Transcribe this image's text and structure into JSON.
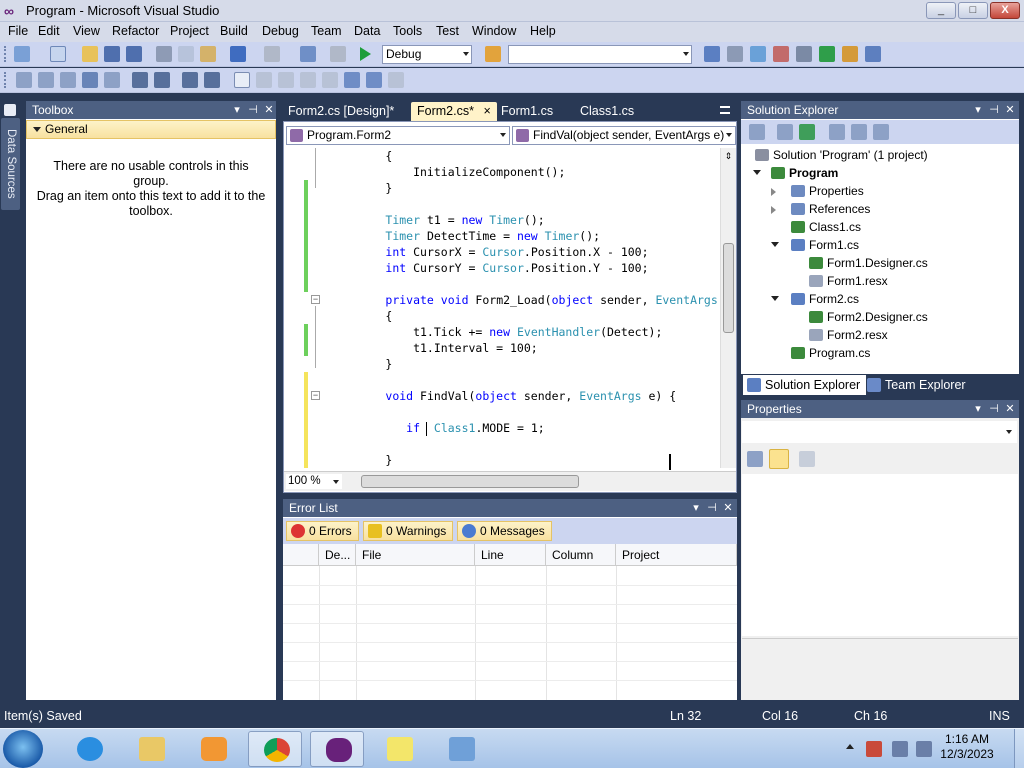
{
  "window": {
    "title": "Program - Microsoft Visual Studio",
    "min": "_",
    "max": "□",
    "close": "X"
  },
  "menu": [
    "File",
    "Edit",
    "View",
    "Refactor",
    "Project",
    "Build",
    "Debug",
    "Team",
    "Data",
    "Tools",
    "Test",
    "Window",
    "Help"
  ],
  "toolbar": {
    "config": "Debug",
    "platform": ""
  },
  "left_strip": {
    "data_sources": "Data Sources"
  },
  "toolbox": {
    "title": "Toolbox",
    "group": "General",
    "empty_line1": "There are no usable controls in this group.",
    "empty_line2": "Drag an item onto this text to add it to the",
    "empty_line3": "toolbox."
  },
  "pane_controls": {
    "pin": "⊣",
    "dropdown": "▾",
    "close": "✕"
  },
  "doc_tabs": [
    {
      "label": "Form2.cs [Design]*"
    },
    {
      "label": "Form2.cs*",
      "close": "×"
    },
    {
      "label": "Form1.cs"
    },
    {
      "label": "Class1.cs"
    }
  ],
  "editor": {
    "class_combo": "Program.Form2",
    "member_combo": "FindVal(object sender, EventArgs e)",
    "zoom": "100 %",
    "lines": [
      {
        "y": 0,
        "parts": [
          {
            "t": "        {",
            "c": ""
          }
        ]
      },
      {
        "y": 1,
        "parts": [
          {
            "t": "            InitializeComponent();",
            "c": ""
          }
        ]
      },
      {
        "y": 2,
        "parts": [
          {
            "t": "        }",
            "c": ""
          }
        ]
      },
      {
        "y": 4,
        "parts": [
          {
            "t": "        ",
            "c": ""
          },
          {
            "t": "Timer",
            "c": "t"
          },
          {
            "t": " t1 = ",
            "c": ""
          },
          {
            "t": "new",
            "c": "k"
          },
          {
            "t": " ",
            "c": ""
          },
          {
            "t": "Timer",
            "c": "t"
          },
          {
            "t": "();",
            "c": ""
          }
        ]
      },
      {
        "y": 5,
        "parts": [
          {
            "t": "        ",
            "c": ""
          },
          {
            "t": "Timer",
            "c": "t"
          },
          {
            "t": " DetectTime = ",
            "c": ""
          },
          {
            "t": "new",
            "c": "k"
          },
          {
            "t": " ",
            "c": ""
          },
          {
            "t": "Timer",
            "c": "t"
          },
          {
            "t": "();",
            "c": ""
          }
        ]
      },
      {
        "y": 6,
        "parts": [
          {
            "t": "        ",
            "c": ""
          },
          {
            "t": "int",
            "c": "k"
          },
          {
            "t": " CursorX = ",
            "c": ""
          },
          {
            "t": "Cursor",
            "c": "t"
          },
          {
            "t": ".Position.X - 100;",
            "c": ""
          }
        ]
      },
      {
        "y": 7,
        "parts": [
          {
            "t": "        ",
            "c": ""
          },
          {
            "t": "int",
            "c": "k"
          },
          {
            "t": " CursorY = ",
            "c": ""
          },
          {
            "t": "Cursor",
            "c": "t"
          },
          {
            "t": ".Position.Y - 100;",
            "c": ""
          }
        ]
      },
      {
        "y": 9,
        "parts": [
          {
            "t": "        ",
            "c": ""
          },
          {
            "t": "private",
            "c": "k"
          },
          {
            "t": " ",
            "c": ""
          },
          {
            "t": "void",
            "c": "k"
          },
          {
            "t": " Form2_Load(",
            "c": ""
          },
          {
            "t": "object",
            "c": "k"
          },
          {
            "t": " sender, ",
            "c": ""
          },
          {
            "t": "EventArgs",
            "c": "t"
          }
        ]
      },
      {
        "y": 10,
        "parts": [
          {
            "t": "        {",
            "c": ""
          }
        ]
      },
      {
        "y": 11,
        "parts": [
          {
            "t": "            t1.Tick += ",
            "c": ""
          },
          {
            "t": "new",
            "c": "k"
          },
          {
            "t": " ",
            "c": ""
          },
          {
            "t": "EventHandler",
            "c": "t"
          },
          {
            "t": "(Detect);",
            "c": ""
          }
        ]
      },
      {
        "y": 12,
        "parts": [
          {
            "t": "            t1.Interval = 100;",
            "c": ""
          }
        ]
      },
      {
        "y": 13,
        "parts": [
          {
            "t": "        }",
            "c": ""
          }
        ]
      },
      {
        "y": 15,
        "parts": [
          {
            "t": "        ",
            "c": ""
          },
          {
            "t": "void",
            "c": "k"
          },
          {
            "t": " FindVal(",
            "c": ""
          },
          {
            "t": "object",
            "c": "k"
          },
          {
            "t": " sender, ",
            "c": ""
          },
          {
            "t": "EventArgs",
            "c": "t"
          },
          {
            "t": " e) {",
            "c": ""
          }
        ]
      },
      {
        "y": 17,
        "parts": [
          {
            "t": "           ",
            "c": ""
          },
          {
            "t": "if",
            "c": "k"
          },
          {
            "t": "  ",
            "c": ""
          },
          {
            "t": "Class1",
            "c": "t"
          },
          {
            "t": ".MODE = 1;",
            "c": ""
          }
        ]
      },
      {
        "y": 19,
        "parts": [
          {
            "t": "        }",
            "c": ""
          }
        ]
      }
    ]
  },
  "error_list": {
    "title": "Error List",
    "errors": "0 Errors",
    "warnings": "0 Warnings",
    "messages": "0 Messages",
    "columns": [
      "De...",
      "File",
      "Line",
      "Column",
      "Project"
    ]
  },
  "solution_explorer": {
    "title": "Solution Explorer",
    "tree": [
      {
        "label": "Solution 'Program' (1 project)",
        "level": 0,
        "bold": false,
        "exp": "",
        "icon": "solution-icon"
      },
      {
        "label": "Program",
        "level": 1,
        "bold": true,
        "exp": "open",
        "icon": "csharp-project-icon"
      },
      {
        "label": "Properties",
        "level": 2,
        "bold": false,
        "exp": "closed",
        "icon": "properties-folder-icon"
      },
      {
        "label": "References",
        "level": 2,
        "bold": false,
        "exp": "closed",
        "icon": "references-folder-icon"
      },
      {
        "label": "Class1.cs",
        "level": 2,
        "bold": false,
        "exp": "",
        "icon": "csharp-file-icon"
      },
      {
        "label": "Form1.cs",
        "level": 2,
        "bold": false,
        "exp": "open",
        "icon": "form-icon"
      },
      {
        "label": "Form1.Designer.cs",
        "level": 3,
        "bold": false,
        "exp": "",
        "icon": "csharp-file-icon"
      },
      {
        "label": "Form1.resx",
        "level": 3,
        "bold": false,
        "exp": "",
        "icon": "resx-file-icon"
      },
      {
        "label": "Form2.cs",
        "level": 2,
        "bold": false,
        "exp": "open",
        "icon": "form-icon"
      },
      {
        "label": "Form2.Designer.cs",
        "level": 3,
        "bold": false,
        "exp": "",
        "icon": "csharp-file-icon"
      },
      {
        "label": "Form2.resx",
        "level": 3,
        "bold": false,
        "exp": "",
        "icon": "resx-file-icon"
      },
      {
        "label": "Program.cs",
        "level": 2,
        "bold": false,
        "exp": "",
        "icon": "csharp-file-icon"
      }
    ],
    "tab_solution": "Solution Explorer",
    "tab_team": "Team Explorer"
  },
  "properties": {
    "title": "Properties"
  },
  "statusbar": {
    "message": "Item(s) Saved",
    "ln": "Ln 32",
    "col": "Col 16",
    "ch": "Ch 16",
    "mode": "INS"
  },
  "taskbar": {
    "time": "1:16 AM",
    "date": "12/3/2023"
  },
  "colors": {
    "accent": "#293955",
    "tab_active": "#fff3c9",
    "keyword": "#0000ff",
    "type": "#2b91af",
    "changed": "#6dd05c",
    "unsaved": "#f5e45c"
  }
}
